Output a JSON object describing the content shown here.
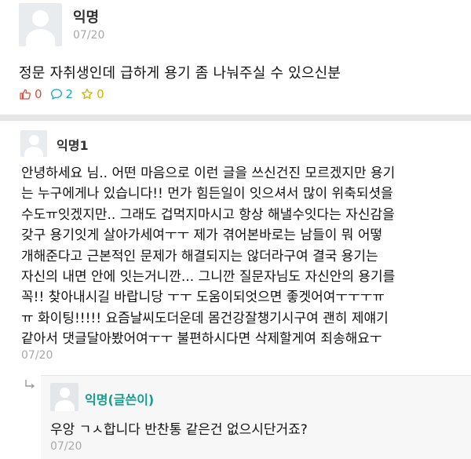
{
  "post": {
    "author": "익명",
    "date": "07/20",
    "body": "정문 자취생인데 급하게 용기 좀 나눠주실 수 있으신분",
    "likes": "0",
    "comments": "2",
    "scraps": "0",
    "colors": {
      "like": "#e24a3c",
      "comment": "#1aa6c9",
      "scrap": "#d3b200"
    }
  },
  "comment": {
    "author": "익명1",
    "lines": [
      "안녕하세요 님.. 어떤 마음으로 이런 글을 쓰신건진 모르겠지만 용기",
      "는 누구에게나 있습니다!! 먼가 힘든일이 잇으셔서 많이 위축되셧을",
      "수도ㅠ잇겠지만.. 그래도 겁먹지마시고 항상 해낼수잇다는 자신감을",
      "갖구 용기잇게 살아가세여ㅜㅜ 제가 겪어본바로는 남들이 뭐 어떻",
      "개해준다고 근본적인 문제가 해결되지는 않더라구여 결국 용기는",
      "자신의 내면 안에 잇는거니깐... 그니깐 질문자님도 자신안의 용기를",
      "꼭!! 찾아내시길 바랍니당 ㅜㅜ 도움이되엇으면 좋겟어여ㅜㅜㅜㅠ",
      "ㅠ 화이팅!!!!! 요즘날씨도더운데 몸건강잘챙기시구여 괜히 제얘기",
      "같아서 댓글달아봤어여ㅜㅜ 불편하시다면 삭제할게여 죄송해요ㅜ"
    ],
    "date": "07/20"
  },
  "reply": {
    "author": "익명(글쓴이)",
    "text": "우앙 ㄱㅅ합니다 반찬통 같은건 없으시단거죠?",
    "date": "07/20"
  }
}
